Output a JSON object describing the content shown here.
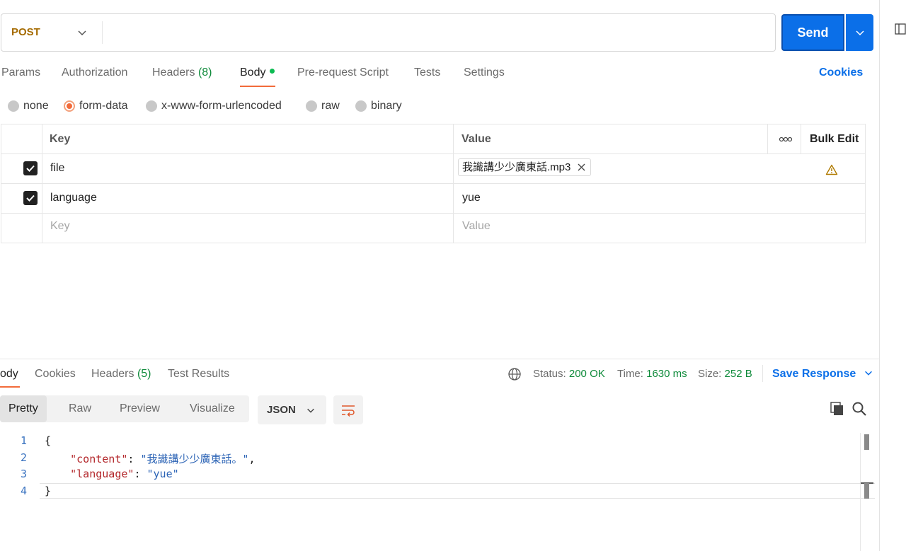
{
  "request": {
    "method": "POST",
    "url_value": "",
    "send_label": "Send",
    "tabs": [
      {
        "label": "Params",
        "count": ""
      },
      {
        "label": "Authorization",
        "count": ""
      },
      {
        "label": "Headers",
        "count": "(8)"
      },
      {
        "label": "Body",
        "count": ""
      },
      {
        "label": "Pre-request Script",
        "count": ""
      },
      {
        "label": "Tests",
        "count": ""
      },
      {
        "label": "Settings",
        "count": ""
      }
    ],
    "active_tab": "Body",
    "cookies_label": "Cookies"
  },
  "body_types": {
    "options": [
      "none",
      "form-data",
      "x-www-form-urlencoded",
      "raw",
      "binary"
    ],
    "selected": "form-data"
  },
  "form_table": {
    "headers": {
      "key": "Key",
      "value": "Value",
      "bulk_edit": "Bulk Edit"
    },
    "rows": [
      {
        "checked": true,
        "key": "file",
        "value": "我識講少少廣東話.mp3",
        "value_type": "file",
        "warning": true
      },
      {
        "checked": true,
        "key": "language",
        "value": "yue",
        "value_type": "text",
        "warning": false
      }
    ],
    "new_row": {
      "key_placeholder": "Key",
      "value_placeholder": "Value"
    }
  },
  "response": {
    "tabs": [
      {
        "label": "ody",
        "count": ""
      },
      {
        "label": "Cookies",
        "count": ""
      },
      {
        "label": "Headers",
        "count": "(5)"
      },
      {
        "label": "Test Results",
        "count": ""
      }
    ],
    "status_label": "Status:",
    "status_value": "200 OK",
    "time_label": "Time:",
    "time_value": "1630 ms",
    "size_label": "Size:",
    "size_value": "252 B",
    "save_label": "Save Response",
    "views": [
      "Pretty",
      "Raw",
      "Preview",
      "Visualize"
    ],
    "active_view": "Pretty",
    "format": "JSON",
    "code_lines": [
      {
        "num": "1",
        "text": "{"
      },
      {
        "num": "2",
        "key": "\"content\"",
        "value": "\"我識講少少廣東話。\""
      },
      {
        "num": "3",
        "key": "\"language\"",
        "value": "\"yue\""
      },
      {
        "num": "4",
        "text": "}"
      }
    ]
  },
  "colors": {
    "accent_blue": "#0b6fe8",
    "accent_orange": "#f26b3a",
    "success_green": "#0e8a3a",
    "method_post": "#a56b00"
  },
  "icons": [
    "chevron-down-icon",
    "globe-icon",
    "copy-icon",
    "search-icon",
    "wrap-lines-icon",
    "warning-icon",
    "close-icon",
    "more-options-icon",
    "side-panel-icon"
  ]
}
